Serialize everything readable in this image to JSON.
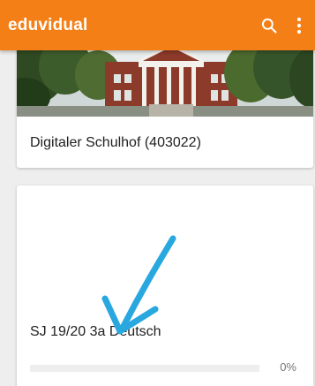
{
  "app": {
    "title": "eduvidual",
    "accent": "#f57f17"
  },
  "toolbar": {
    "search_icon": "search-icon",
    "more_icon": "more-vert-icon"
  },
  "courses": [
    {
      "name": "Digitaler Schulhof (403022)"
    },
    {
      "name": "SJ 19/20 3a Deutsch",
      "progress_percent": 0,
      "progress_label": "0%"
    }
  ],
  "annotation": {
    "arrow_color": "#29a8e0"
  }
}
